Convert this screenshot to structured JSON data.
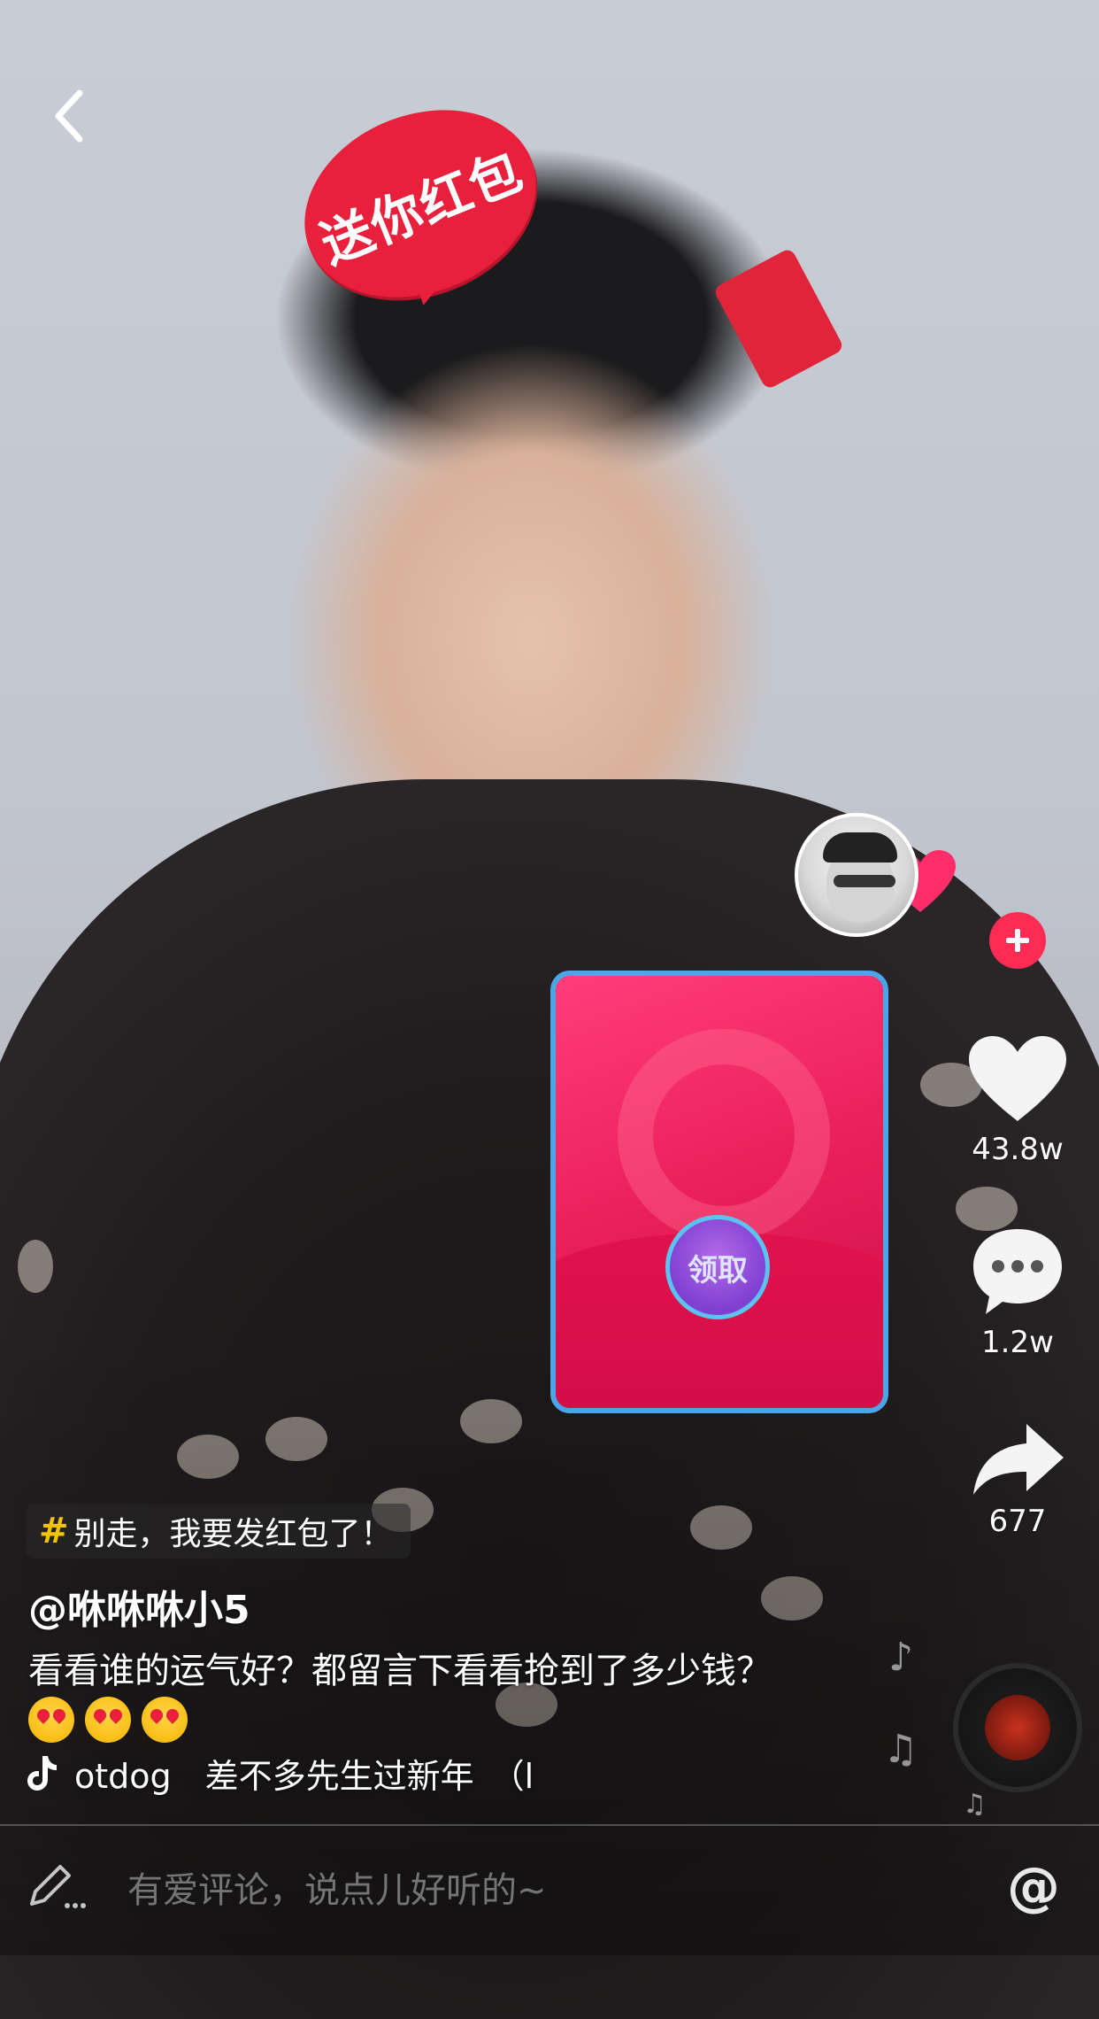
{
  "navigation": {
    "back_icon": "chevron-left-icon"
  },
  "video": {
    "sticker_text": "送你红包"
  },
  "red_packet": {
    "claim_label": "领取",
    "accent_color": "#ea1f5a",
    "border_color": "#4aa6e6"
  },
  "side_actions": {
    "like_count": "43.8w",
    "comment_count": "1.2w",
    "share_count": "677"
  },
  "post": {
    "hashtag": "别走，我要发红包了！",
    "username": "@咻咻咻小5",
    "caption": "看看谁的运气好？都留言下看看抢到了多少钱？",
    "emoji_count": 3,
    "music": "otdog　差不多先生过新年　（l"
  },
  "comment_bar": {
    "placeholder": "有爱评论，说点儿好听的~",
    "at_symbol": "@"
  },
  "colors": {
    "brand_pink": "#fe2c55",
    "hashtag_yellow": "#f5c400"
  }
}
